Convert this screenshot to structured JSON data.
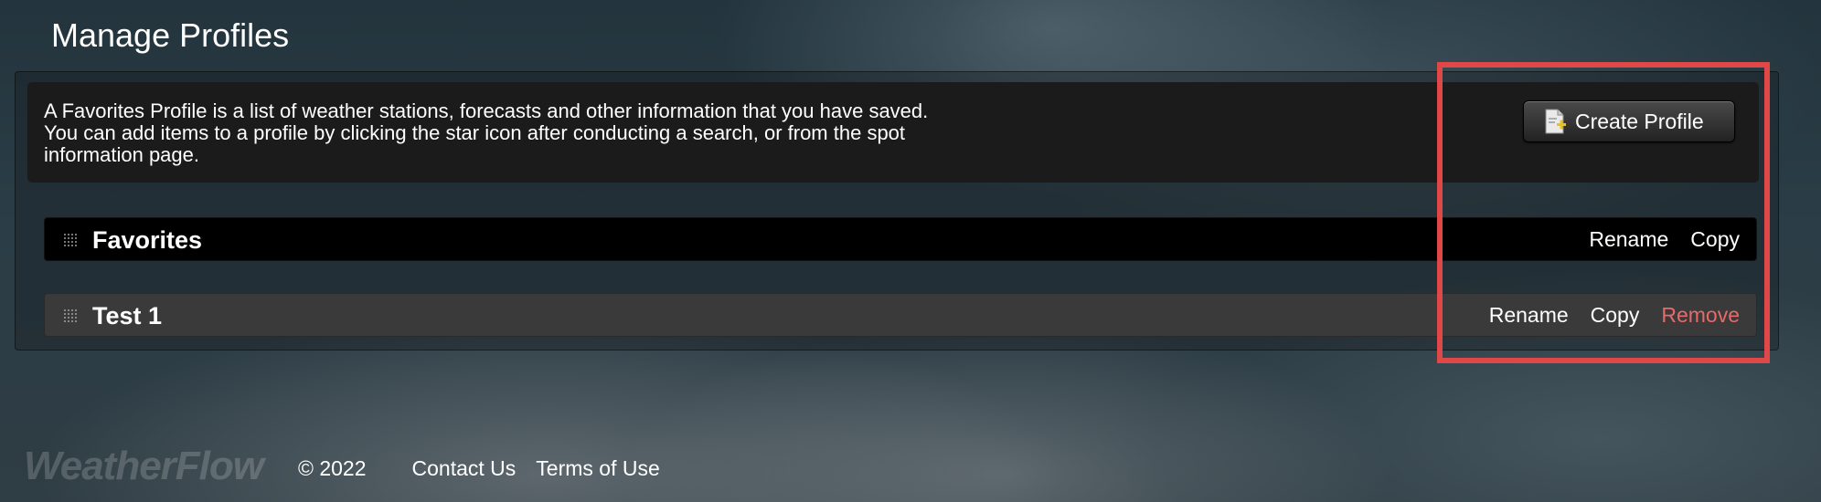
{
  "header": {
    "title": "Manage Profiles"
  },
  "info": {
    "text": "A Favorites Profile is a list of weather stations, forecasts and other information that you have saved. You can add items to a profile by clicking the star icon after conducting a search, or from the spot information page."
  },
  "create_button": {
    "label": "Create Profile",
    "icon": "add-document-icon"
  },
  "profiles": [
    {
      "name": "Favorites",
      "actions": {
        "rename": "Rename",
        "copy": "Copy"
      }
    },
    {
      "name": "Test 1",
      "actions": {
        "rename": "Rename",
        "copy": "Copy",
        "remove": "Remove"
      }
    }
  ],
  "footer": {
    "logo": "WeatherFlow",
    "copyright": "© 2022",
    "links": {
      "contact": "Contact Us",
      "terms": "Terms of Use"
    }
  },
  "colors": {
    "remove": "#e66a6a",
    "highlight": "#e04848"
  }
}
